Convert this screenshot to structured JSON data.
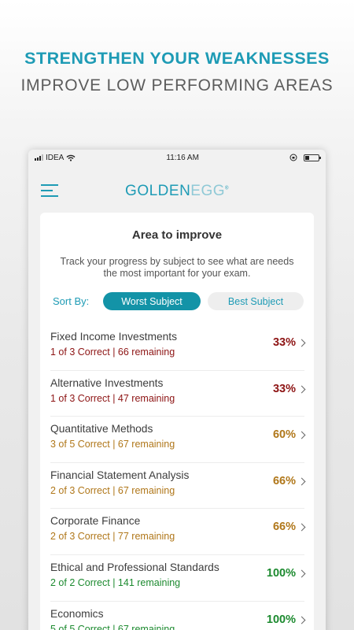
{
  "headline": {
    "line1": "STRENGTHEN YOUR WEAKNESSES",
    "line2": "IMPROVE LOW PERFORMING AREAS"
  },
  "status_bar": {
    "carrier": "IDEA",
    "time": "11:16 AM"
  },
  "app": {
    "logo_main": "GOLDEN",
    "logo_accent": "EGG",
    "logo_mark": "®"
  },
  "card": {
    "title": "Area to improve",
    "description": "Track your progress by subject to see what are needs the most important for your exam.",
    "sort_label": "Sort By:",
    "sort_options": [
      "Worst Subject",
      "Best Subject"
    ],
    "sort_selected": "Worst Subject"
  },
  "subjects": [
    {
      "name": "Fixed Income Investments",
      "stats": "1 of 3  Correct | 66 remaining",
      "percent": "33%",
      "level": "red"
    },
    {
      "name": "Alternative Investments",
      "stats": "1 of 3  Correct | 47 remaining",
      "percent": "33%",
      "level": "red"
    },
    {
      "name": "Quantitative Methods",
      "stats": "3 of 5  Correct | 67 remaining",
      "percent": "60%",
      "level": "amber"
    },
    {
      "name": "Financial Statement Analysis",
      "stats": "2 of 3  Correct | 67 remaining",
      "percent": "66%",
      "level": "amber"
    },
    {
      "name": "Corporate Finance",
      "stats": "2 of 3  Correct | 77 remaining",
      "percent": "66%",
      "level": "amber"
    },
    {
      "name": "Ethical and Professional Standards",
      "stats": "2 of 2  Correct | 141 remaining",
      "percent": "100%",
      "level": "green"
    },
    {
      "name": "Economics",
      "stats": "5 of 5  Correct | 67 remaining",
      "percent": "100%",
      "level": "green"
    }
  ],
  "colors": {
    "accent": "#1e9bb5",
    "red": "#8d1414",
    "amber": "#b0771a",
    "green": "#1c8a2f"
  }
}
